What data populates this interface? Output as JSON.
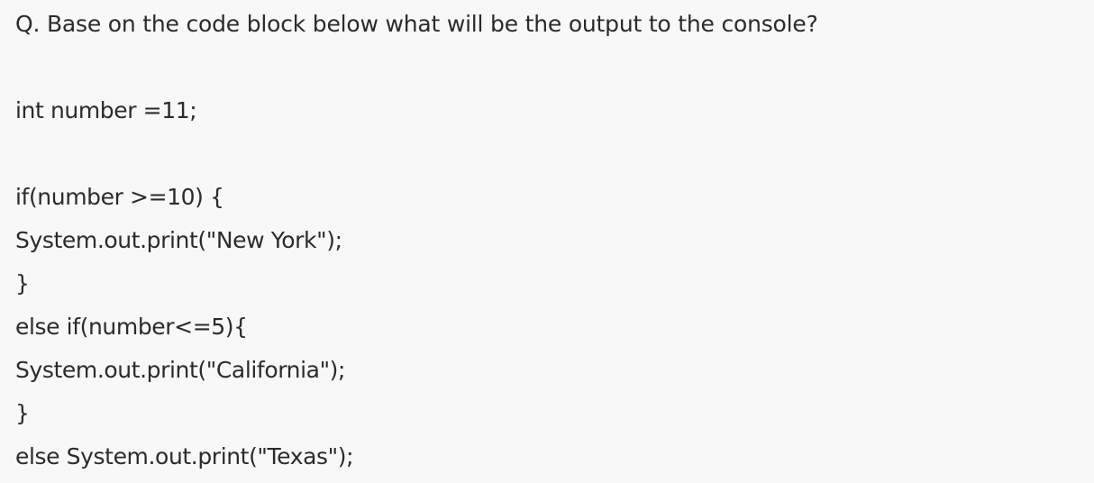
{
  "question": {
    "text": "Q. Base on the code block below what will be the output to the console?"
  },
  "code": {
    "lines": [
      "int number =11;",
      "if(number >=10) {",
      "System.out.print(\"New York\");",
      "}",
      "else if(number<=5){",
      "System.out.print(\"California\");",
      "}",
      "else System.out.print(\"Texas\");"
    ]
  }
}
